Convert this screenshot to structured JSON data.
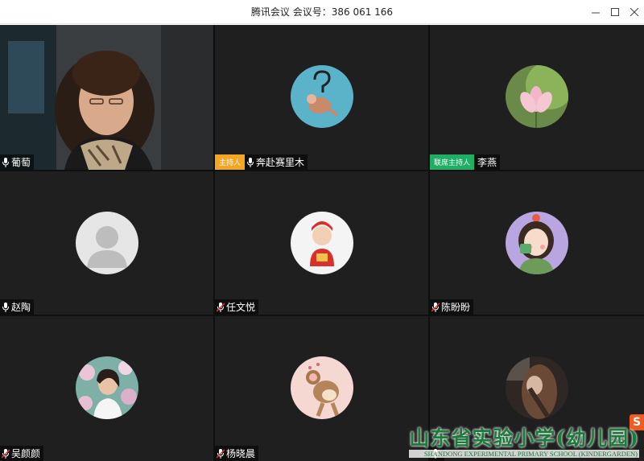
{
  "window": {
    "title": "腾讯会议 会议号：386 061 166",
    "minimize_icon": "minimize-icon",
    "maximize_icon": "maximize-icon",
    "close_icon": "close-icon"
  },
  "participants": [
    {
      "name": "葡萄",
      "role": "",
      "mic": "on",
      "media": "video"
    },
    {
      "name": "奔赴赛里木",
      "role": "主持人",
      "mic": "on",
      "media": "avatar-cartoon-mouse"
    },
    {
      "name": "李燕",
      "role": "联席主持人",
      "mic": "none",
      "media": "avatar-lotus"
    },
    {
      "name": "赵陶",
      "role": "",
      "mic": "on",
      "media": "avatar-default"
    },
    {
      "name": "任文悦",
      "role": "",
      "mic": "muted",
      "media": "avatar-cartoon-child"
    },
    {
      "name": "陈盼盼",
      "role": "",
      "mic": "muted",
      "media": "avatar-girl-drawing"
    },
    {
      "name": "吴颜颜",
      "role": "",
      "mic": "muted",
      "media": "avatar-photo-woman"
    },
    {
      "name": "杨晓晨",
      "role": "",
      "mic": "muted",
      "media": "avatar-cartoon-jerry"
    },
    {
      "name": "",
      "role": "",
      "mic": "muted",
      "media": "avatar-photo-hair"
    }
  ],
  "watermark": {
    "cn": "山东省实验小学(幼儿园)",
    "en": "SHANDONG EXPERIMENTAL PRIMARY SCHOOL (KINDERGARDEN)"
  },
  "side_logo": "S",
  "colors": {
    "host_badge": "#f5a623",
    "cohost_badge": "#1fae64",
    "tile_bg": "#1f1f1f",
    "watermark": "#1d7a3a"
  }
}
